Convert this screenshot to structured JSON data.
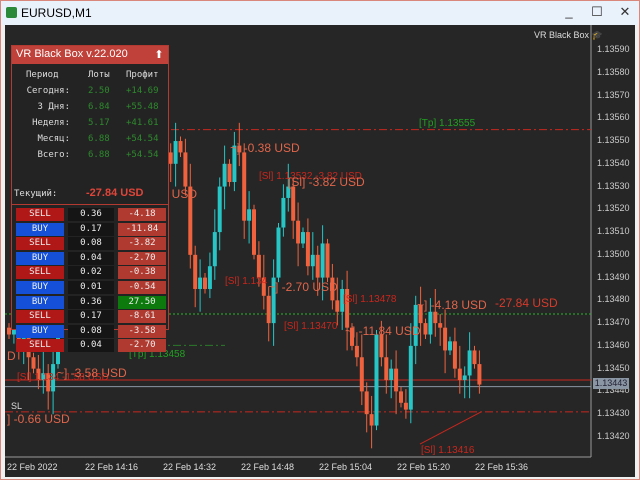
{
  "window": {
    "title": "EURUSD,M1",
    "minimize": "_",
    "maximize": "☐",
    "close": "✕"
  },
  "chart": {
    "indicator_label": "VR Black Box",
    "price_ticks": [
      "1.13590",
      "1.13580",
      "1.13570",
      "1.13560",
      "1.13550",
      "1.13540",
      "1.13530",
      "1.13520",
      "1.13510",
      "1.13500",
      "1.13490",
      "1.13480",
      "1.13470",
      "1.13460",
      "1.13450",
      "1.13440",
      "1.13430",
      "1.13420"
    ],
    "time_ticks": [
      "22 Feb 2022",
      "22 Feb 14:16",
      "22 Feb 14:32",
      "22 Feb 14:48",
      "22 Feb 15:04",
      "22 Feb 15:20",
      "22 Feb 15:36"
    ],
    "bid_price": "1.13443",
    "colors": {
      "bull": "#26c6c6",
      "bear": "#f0623e",
      "background": "#262626",
      "tp": "#22a022",
      "sl": "#c8261d"
    },
    "closes": [
      1.13465,
      1.1347,
      1.1346,
      1.13468,
      1.13455,
      1.1345,
      1.13445,
      1.13448,
      1.1344,
      1.13452,
      1.13485,
      1.13497,
      1.13505,
      1.1352,
      1.13515,
      1.13535,
      1.13525,
      1.135,
      1.1351,
      1.1353,
      1.13535,
      1.1352,
      1.1353,
      1.1354,
      1.13535,
      1.13545,
      1.13538,
      1.13542,
      1.1353,
      1.13535,
      1.13528,
      1.1354,
      1.13545,
      1.1354,
      1.1355,
      1.13545,
      1.1353,
      1.135,
      1.13485,
      1.1349,
      1.13485,
      1.13495,
      1.1351,
      1.1353,
      1.1354,
      1.13532,
      1.13548,
      1.13545,
      1.13515,
      1.1352,
      1.135,
      1.1349,
      1.13482,
      1.1347,
      1.1349,
      1.13512,
      1.13525,
      1.1353,
      1.13515,
      1.13505,
      1.1351,
      1.13495,
      1.135,
      1.1349,
      1.13505,
      1.1349,
      1.1348,
      1.13475,
      1.13485,
      1.13468,
      1.1346,
      1.13455,
      1.1344,
      1.1343,
      1.13425,
      1.13465,
      1.13455,
      1.13445,
      1.1345,
      1.1344,
      1.13435,
      1.13432,
      1.1346,
      1.13478,
      1.1347,
      1.13465,
      1.13475,
      1.1347,
      1.13468,
      1.13458,
      1.13462,
      1.1345,
      1.13445,
      1.13447,
      1.13458,
      1.13452,
      1.13443
    ],
    "labels": {
      "tp_main": "[Tp] 1.13555",
      "tp_2": "[Tp] 1.13458",
      "l038": "~] -0.38 USD",
      "sl_1": "[Sl] 1.13532 -3.82 USD",
      "l382": "[Sl] -3.82 USD",
      "usd": "] USD",
      "sl_2": "[Sl] 1.134",
      "l270": "~] -2.70 USD",
      "sl_3": "[Sl] 1.13478",
      "l418": "~] -4.18 USD",
      "total": "-27.84 USD",
      "sl_4": "[Sl] 1.13470",
      "l1184": "~] -11.84 USD",
      "sl_5": "[Sl] 1.134   -1.58 USD",
      "l358": "~] -3.58 USD",
      "sl_tag": "SL",
      "l066": "] -0.66 USD",
      "sl_6": "[Sl] 1.13416",
      "d": "D"
    }
  },
  "panel": {
    "title": "VR Black Box v.22.020",
    "headers": {
      "period": "Период",
      "lots": "Лоты",
      "profit": "Профит"
    },
    "stats": [
      {
        "period": "Сегодня:",
        "lots": "2.50",
        "profit": "+14.69"
      },
      {
        "period": "3 Дня:",
        "lots": "6.84",
        "profit": "+55.48"
      },
      {
        "period": "Неделя:",
        "lots": "5.17",
        "profit": "+41.61"
      },
      {
        "period": "Месяц:",
        "lots": "6.88",
        "profit": "+54.54"
      },
      {
        "period": "Всего:",
        "lots": "6.88",
        "profit": "+54.54"
      }
    ],
    "current_label": "Текущий:",
    "current_value": "-27.84 USD",
    "trades": [
      {
        "type": "SELL",
        "lots": "0.36",
        "profit": "-4.18"
      },
      {
        "type": "BUY",
        "lots": "0.17",
        "profit": "-11.84"
      },
      {
        "type": "SELL",
        "lots": "0.08",
        "profit": "-3.82"
      },
      {
        "type": "BUY",
        "lots": "0.04",
        "profit": "-2.70"
      },
      {
        "type": "SELL",
        "lots": "0.02",
        "profit": "-0.38"
      },
      {
        "type": "BUY",
        "lots": "0.01",
        "profit": "-0.54"
      },
      {
        "type": "BUY",
        "lots": "0.36",
        "profit": "27.50"
      },
      {
        "type": "SELL",
        "lots": "0.17",
        "profit": "-8.61"
      },
      {
        "type": "BUY",
        "lots": "0.08",
        "profit": "-3.58"
      },
      {
        "type": "SELL",
        "lots": "0.04",
        "profit": "-2.70"
      }
    ]
  }
}
